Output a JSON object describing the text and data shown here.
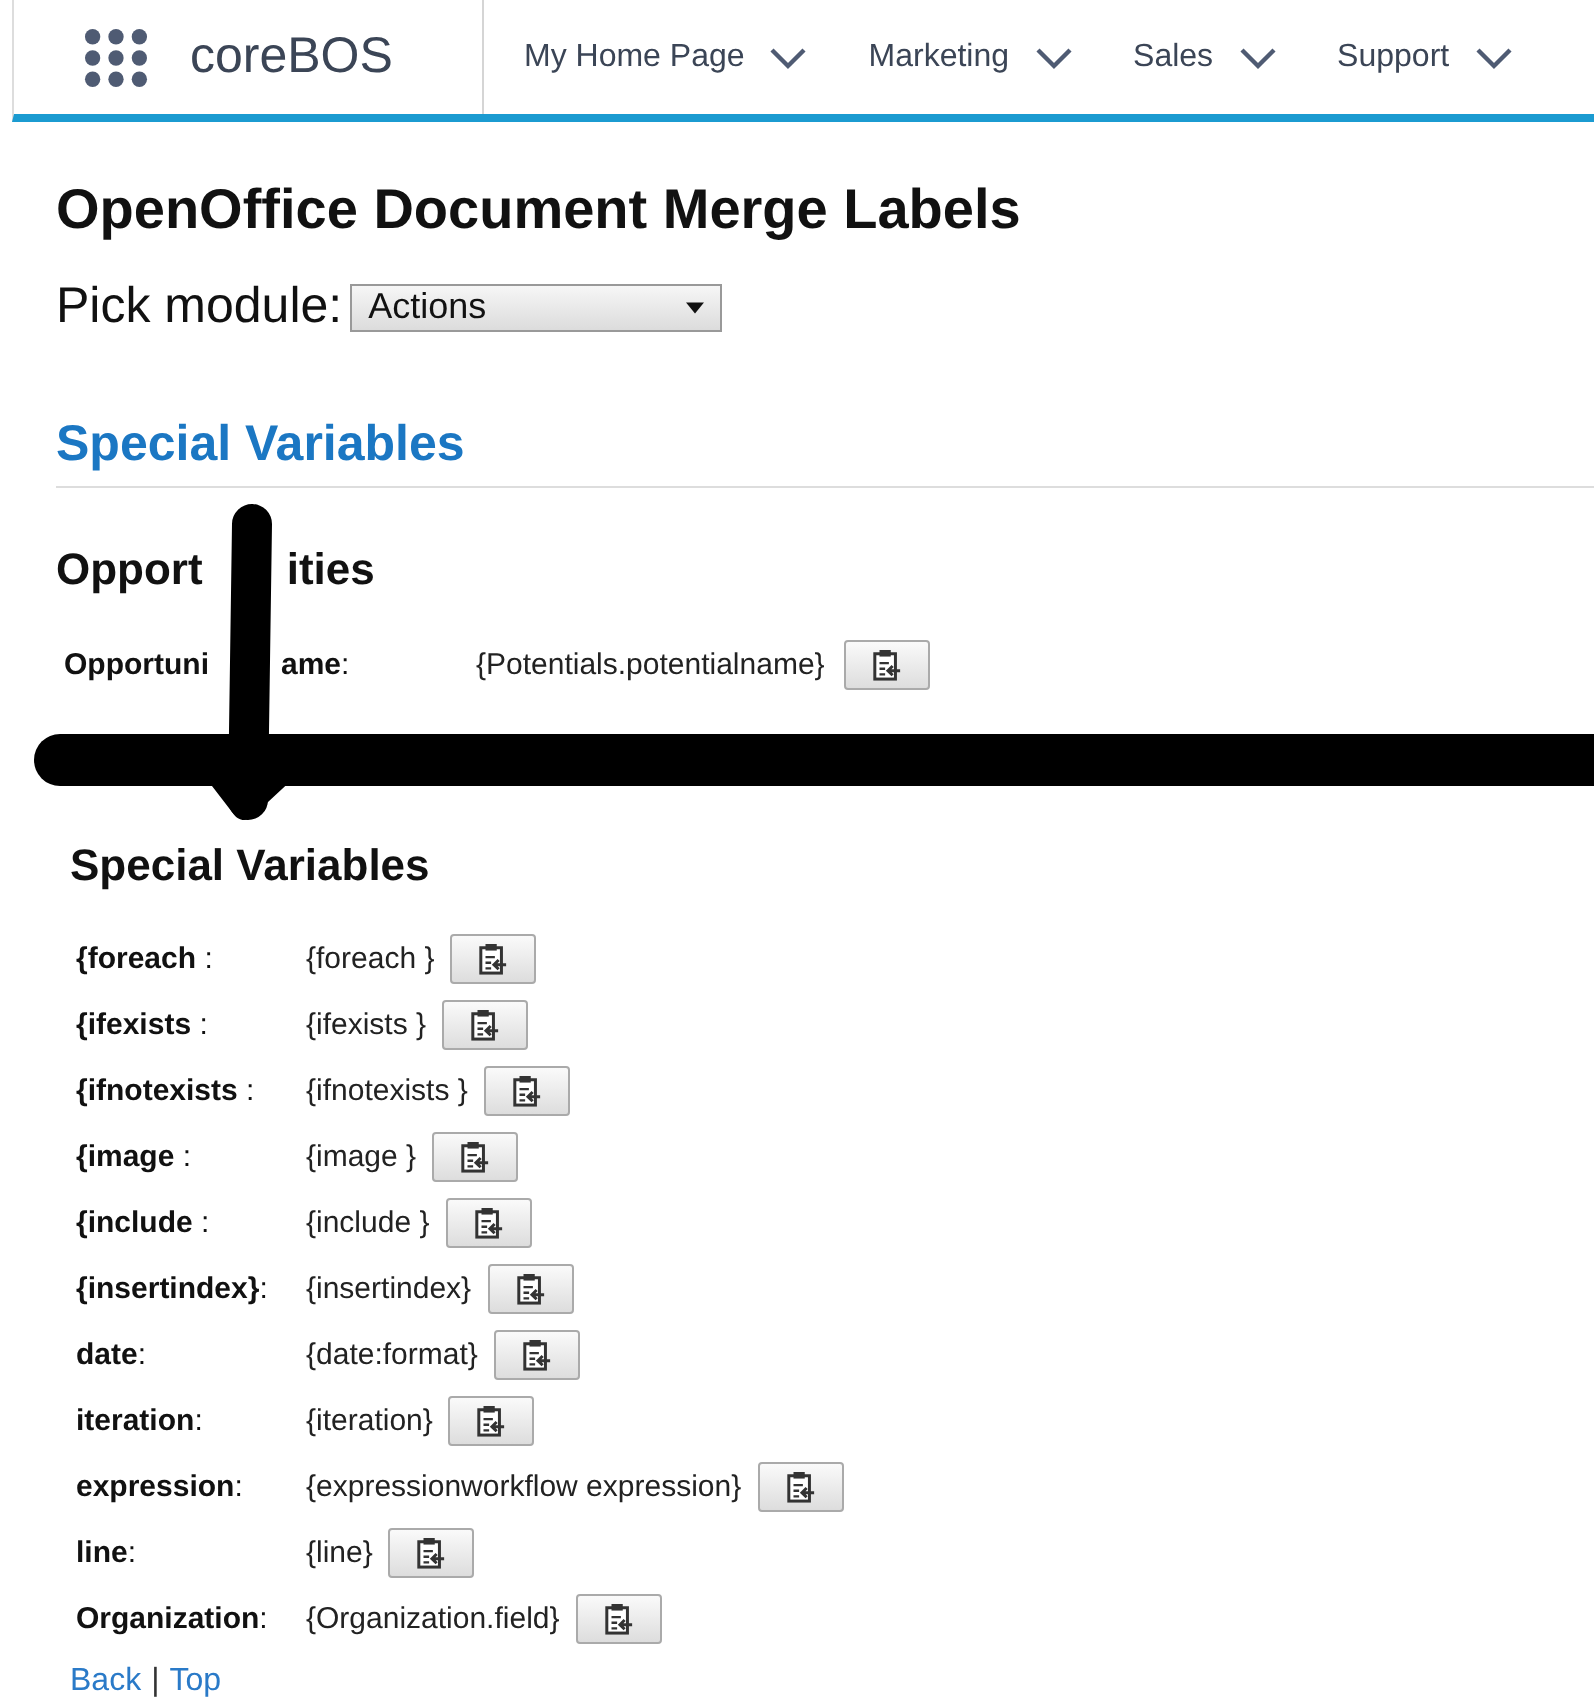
{
  "nav": {
    "brand": "coreBOS",
    "menus": [
      {
        "label": "My Home Page"
      },
      {
        "label": "Marketing"
      },
      {
        "label": "Sales"
      },
      {
        "label": "Support"
      }
    ]
  },
  "title": "OpenOffice Document Merge Labels",
  "pick_module": {
    "label": "Pick module:",
    "value": "Actions"
  },
  "section_title": "Special Variables",
  "opportunities": {
    "heading_left": "Opport",
    "heading_right": "ities",
    "rows": [
      {
        "label_left": "Opportuni",
        "label_right": "ame",
        "colon": ":",
        "value": "{Potentials.potentialname}"
      }
    ]
  },
  "special_variables": {
    "heading": "Special Variables",
    "rows": [
      {
        "label": "{foreach",
        "suffix": " :",
        "value": "{foreach }"
      },
      {
        "label": "{ifexists",
        "suffix": " :",
        "value": "{ifexists }"
      },
      {
        "label": "{ifnotexists",
        "suffix": " :",
        "value": "{ifnotexists }"
      },
      {
        "label": "{image",
        "suffix": " :",
        "value": "{image }"
      },
      {
        "label": "{include",
        "suffix": " :",
        "value": "{include }"
      },
      {
        "label": "{insertindex}",
        "suffix": ":",
        "value": "{insertindex}"
      },
      {
        "label": "date",
        "suffix": ":",
        "value": "{date:format}"
      },
      {
        "label": "iteration",
        "suffix": ":",
        "value": "{iteration}"
      },
      {
        "label": "expression",
        "suffix": ":",
        "value": "{expressionworkflow expression}"
      },
      {
        "label": "line",
        "suffix": ":",
        "value": "{line}"
      },
      {
        "label": "Organization",
        "suffix": ":",
        "value": "{Organization.field}"
      }
    ]
  },
  "footer": {
    "links": [
      "Back",
      "Top"
    ],
    "separator": "|"
  }
}
